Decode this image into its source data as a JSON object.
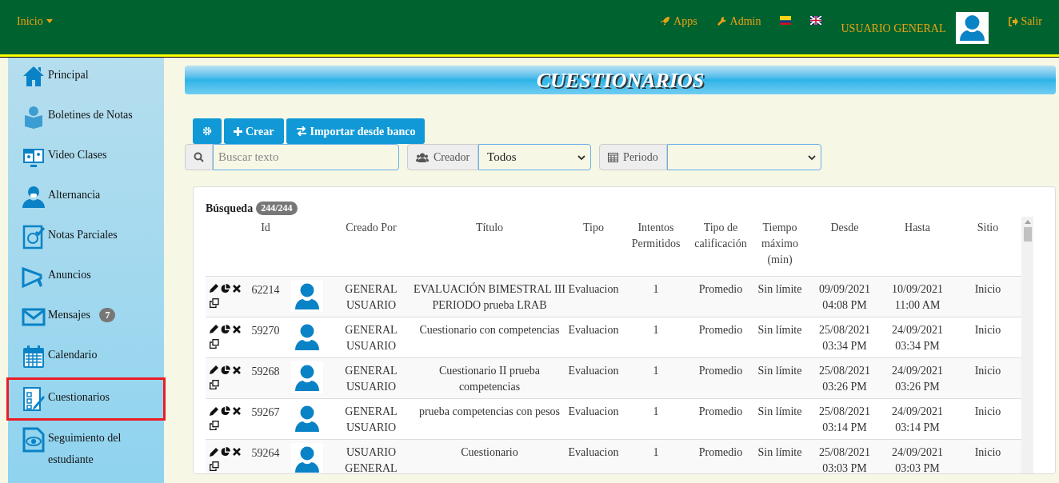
{
  "header": {
    "menu": "Inicio",
    "links": [
      {
        "kind": "apps",
        "label": "Apps"
      },
      {
        "kind": "admin",
        "label": "Admin"
      }
    ],
    "user": "USUARIO GENERAL",
    "logout": "Salir"
  },
  "sidebar": {
    "items": [
      {
        "kind": "home",
        "label": "Principal",
        "selected": false
      },
      {
        "kind": "reader",
        "label": "Boletines de Notas",
        "selected": false
      },
      {
        "kind": "video",
        "label": "Video Clases",
        "selected": false
      },
      {
        "kind": "person",
        "label": "Alternancia",
        "selected": false
      },
      {
        "kind": "grade",
        "label": "Notas Parciales",
        "selected": false
      },
      {
        "kind": "megaphone",
        "label": "Anuncios",
        "selected": false
      },
      {
        "kind": "mail",
        "label": "Mensajes",
        "badge": "7",
        "selected": false
      },
      {
        "kind": "calendar",
        "label": "Calendario",
        "selected": false
      },
      {
        "kind": "checklist",
        "label": "Cuestionarios",
        "selected": true
      },
      {
        "kind": "eye",
        "label": "Seguimiento del estudiante",
        "selected": false
      }
    ]
  },
  "page_title": "CUESTIONARIOS",
  "toolbar": [
    {
      "kind": "settings"
    },
    {
      "kind": "add",
      "label": "Crear"
    },
    {
      "kind": "import",
      "label": "Importar desde banco"
    }
  ],
  "filters": {
    "search": {
      "placeholder": "Buscar texto"
    },
    "creator": {
      "label": "Creador",
      "value": "Todos"
    },
    "period": {
      "label": "Periodo"
    }
  },
  "results": {
    "label": "Búsqueda",
    "count": "244/244"
  },
  "table": {
    "columns": [
      "Id",
      "Creado Por",
      "Título",
      "Tipo",
      "Intentos Permitidos",
      "Tipo de calificación",
      "Tiempo máximo (min)",
      "Desde",
      "Hasta",
      "Sitio"
    ],
    "rows": [
      {
        "id": "62214",
        "creator": "GENERAL USUARIO",
        "title": "EVALUACIÓN BIMESTRAL III PERIODO prueba LRAB",
        "type": "Evaluacion",
        "attempts": "1",
        "grading": "Promedio",
        "time": "Sin límite",
        "from": [
          "09/09/2021",
          "04:08 PM"
        ],
        "to": [
          "10/09/2021",
          "11:00 AM"
        ],
        "site": "Inicio"
      },
      {
        "id": "59270",
        "creator": "GENERAL USUARIO",
        "title": "Cuestionario con competencias",
        "type": "Evaluacion",
        "attempts": "1",
        "grading": "Promedio",
        "time": "Sin límite",
        "from": [
          "25/08/2021",
          "03:34 PM"
        ],
        "to": [
          "24/09/2021",
          "03:34 PM"
        ],
        "site": "Inicio"
      },
      {
        "id": "59268",
        "creator": "GENERAL USUARIO",
        "title": "Cuestionario II prueba competencias",
        "type": "Evaluacion",
        "attempts": "1",
        "grading": "Promedio",
        "time": "Sin límite",
        "from": [
          "25/08/2021",
          "03:26 PM"
        ],
        "to": [
          "24/09/2021",
          "03:26 PM"
        ],
        "site": "Inicio"
      },
      {
        "id": "59267",
        "creator": "GENERAL USUARIO",
        "title": "prueba competencias con pesos",
        "type": "Evaluacion",
        "attempts": "1",
        "grading": "Promedio",
        "time": "Sin límite",
        "from": [
          "25/08/2021",
          "03:14 PM"
        ],
        "to": [
          "24/09/2021",
          "03:14 PM"
        ],
        "site": "Inicio"
      },
      {
        "id": "59264",
        "creator": "USUARIO GENERAL",
        "title": "Cuestionario",
        "type": "Evaluacion",
        "attempts": "1",
        "grading": "Promedio",
        "time": "Sin límite",
        "from": [
          "25/08/2021",
          "03:03 PM"
        ],
        "to": [
          "24/09/2021",
          "03:03 PM"
        ],
        "site": "Inicio"
      }
    ]
  }
}
